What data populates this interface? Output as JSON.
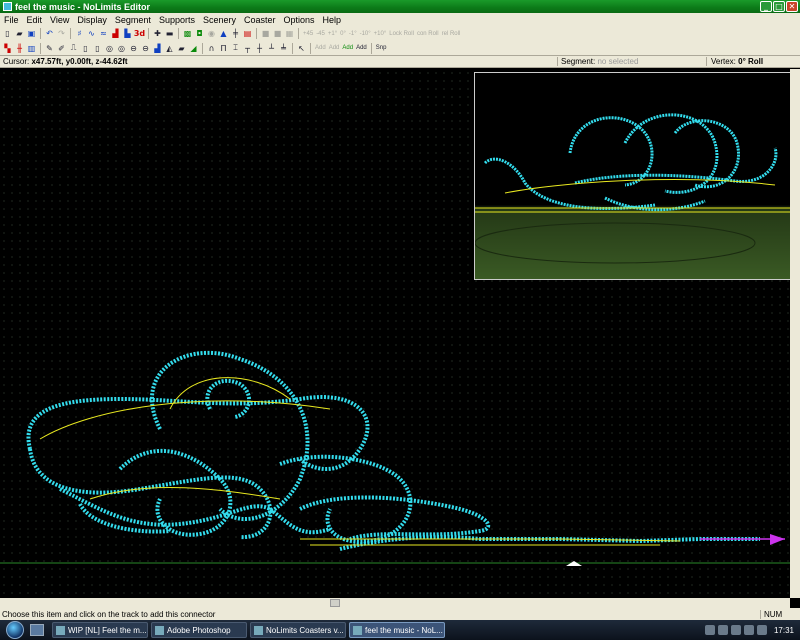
{
  "window": {
    "title": "feel the music - NoLimits Editor",
    "min": "_",
    "max": "□",
    "close": "✕"
  },
  "menu": [
    "File",
    "Edit",
    "View",
    "Display",
    "Segment",
    "Supports",
    "Scenery",
    "Coaster",
    "Options",
    "Help"
  ],
  "toolbar": {
    "labels": {
      "threeD": "3d",
      "plus45": "+45",
      "minus45": "-45",
      "plus1": "+1°",
      "zero": "0°",
      "minus1": "-1°",
      "minus10": "-10°",
      "plus10": "+10°",
      "lock": "Lock Roll",
      "con": "con Roll",
      "rel": "rel Roll",
      "add1": "Add",
      "add2": "Add",
      "add3": "Add",
      "add4": "Add",
      "snp": "Snp"
    }
  },
  "infobar": {
    "cursor_label": "Cursor:",
    "cursor_value": "x47.57ft, y0.00ft, z-44.62ft",
    "segment_label": "Segment:",
    "segment_value": "no selected",
    "vertex_label": "Vertex:",
    "vertex_value": "0° Roll"
  },
  "status": {
    "message": "Choose this item and click on the track to add this connector",
    "num": "NUM"
  },
  "taskbar": {
    "tasks": [
      "WIP [NL] Feel the m...",
      "Adobe Photoshop",
      "NoLimits Coasters v...",
      "feel the music - NoL..."
    ],
    "clock": "17:31"
  },
  "colors": {
    "track": "#33ddee",
    "support": "#e8e820",
    "ground": "#3a5a24",
    "title_bar": "#0c7a18",
    "connector": "#cc33ee"
  }
}
